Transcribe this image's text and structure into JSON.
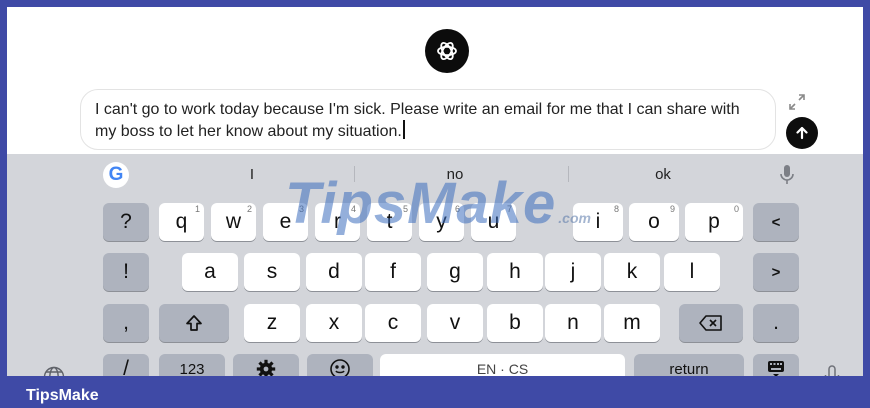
{
  "app": {
    "logo_icon": "openai-logo-icon"
  },
  "composer": {
    "text": "I can't go to work today because I'm sick. Please write an email for me that I can share with my boss to let her know about my situation.",
    "expand_icon": "expand-arrows-icon",
    "send_icon": "arrow-up-icon"
  },
  "keyboard": {
    "provider_icon": "google-g-icon",
    "provider_label": "G",
    "suggestions": [
      "I",
      "no",
      "ok"
    ],
    "row1": [
      {
        "label": "?",
        "hint": ""
      },
      {
        "label": "q",
        "hint": "1"
      },
      {
        "label": "w",
        "hint": "2"
      },
      {
        "label": "e",
        "hint": "3"
      },
      {
        "label": "r",
        "hint": "4"
      },
      {
        "label": "t",
        "hint": "5"
      },
      {
        "label": "y",
        "hint": "6"
      },
      {
        "label": "u",
        "hint": "7"
      },
      {
        "label": "i",
        "hint": "8"
      },
      {
        "label": "o",
        "hint": "9"
      },
      {
        "label": "p",
        "hint": "0"
      },
      {
        "label": "<",
        "hint": ""
      }
    ],
    "row2": [
      "!",
      "a",
      "s",
      "d",
      "f",
      "g",
      "h",
      "j",
      "k",
      "l",
      ">"
    ],
    "row3": [
      ",",
      "z",
      "x",
      "c",
      "v",
      "b",
      "n",
      "m",
      "."
    ],
    "row4": {
      "slash": "/",
      "numbers": "123",
      "space": "EN · CS",
      "return": "return"
    }
  },
  "watermark": {
    "main": "TipsMake",
    "suffix": ".com"
  },
  "footer": {
    "brand": "TipsMake"
  },
  "colors": {
    "frame_border": "#3f4aa6",
    "keyboard_bg": "#d3d5da",
    "fn_key": "#aeb3be"
  }
}
